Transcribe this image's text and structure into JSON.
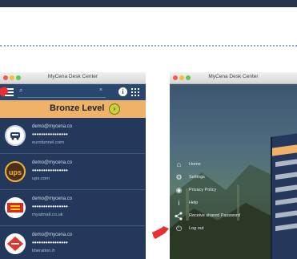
{
  "window1": {
    "title": "MyCena Desk Center",
    "search_placeholder": "",
    "search_clear": "×",
    "info_glyph": "i",
    "level_label": "Bronze Level",
    "level_button_glyph": "›",
    "accounts": [
      {
        "email": "demo@mycena.co",
        "password": "••••••••••••••••",
        "site": "eurotunnel.com",
        "logo": "eurotunnel-logo"
      },
      {
        "email": "demo@mycena.co",
        "password": "••••••••••••••••",
        "site": "ups.com",
        "logo": "ups-logo"
      },
      {
        "email": "demo@mycena.co",
        "password": "••••••••••••••••",
        "site": "myatmail.co.uk",
        "logo": "royalmail-logo"
      },
      {
        "email": "demo@mycena.co",
        "password": "••••••••••••••••",
        "site": "liberation.fr",
        "logo": "libe-logo"
      }
    ]
  },
  "window2": {
    "title": "MyCena Desk Center",
    "menu": [
      {
        "icon": "home-icon",
        "glyph": "⌂",
        "label": "Home"
      },
      {
        "icon": "settings-icon",
        "glyph": "⚙",
        "label": "Settings"
      },
      {
        "icon": "privacy-icon",
        "glyph": "◉",
        "label": "Privacy Policy"
      },
      {
        "icon": "help-icon",
        "glyph": "i",
        "label": "Help"
      },
      {
        "icon": "share-icon",
        "glyph": "<",
        "label": "Receive shared Password"
      },
      {
        "icon": "logout-icon",
        "glyph": "⏻",
        "label": "Log out"
      }
    ]
  },
  "colors": {
    "accent": "#e8312f",
    "level": "#f0b268",
    "app_bg": "#23385a"
  }
}
